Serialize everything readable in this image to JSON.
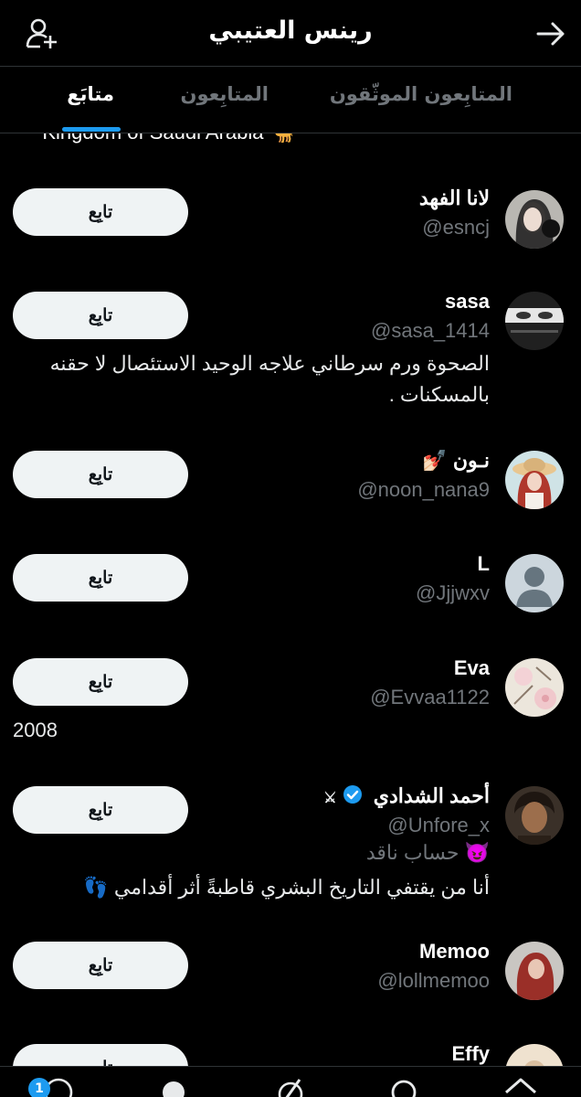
{
  "header": {
    "title": "رينس العتيبي"
  },
  "tabs": [
    {
      "label": "المتابِعون الموثّقون",
      "active": false
    },
    {
      "label": "المتابِعون",
      "active": false
    },
    {
      "label": "متابَع",
      "active": true
    }
  ],
  "top_cut_text": "Kingdom of Saudi Arabia 🐪",
  "users": [
    {
      "name": "لانا الفهد",
      "handle": "@esncj",
      "bio": "",
      "follow_label": "تابِع"
    },
    {
      "name": "sasa",
      "handle": "@sasa_1414",
      "bio": "الصحوة ورم سرطاني علاجه الوحيد الاستئصال لا حقنه بالمسكنات .",
      "follow_label": "تابِع"
    },
    {
      "name": "نـون 💅🏻",
      "handle": "@noon_nana9",
      "bio": "",
      "follow_label": "تابِع"
    },
    {
      "name": "L",
      "handle": "@Jjjwxv",
      "bio": "",
      "follow_label": "تابِع"
    },
    {
      "name": "Eva",
      "handle": "@Evvaa1122",
      "bio": "2008",
      "follow_label": "تابِع"
    },
    {
      "name": "أحمد الشدادي",
      "name_suffix": "⚔",
      "handle": "@Unfore_x",
      "subtitle": "😈 حساب ناقد",
      "bio": "أنا من يقتفي التاريخ البشري قاطبةً أثر أقدامي 👣",
      "follow_label": "تابِع",
      "verified": true
    },
    {
      "name": "Memoo",
      "handle": "@lollmemoo",
      "bio": "",
      "follow_label": "تابِع"
    },
    {
      "name": "Effy",
      "handle": "",
      "bio": "",
      "follow_label": "تابِع"
    }
  ],
  "bottom_nav": {
    "badge_count": "1"
  },
  "colors": {
    "accent": "#1d9bf0",
    "background": "#000000",
    "muted": "#71767b",
    "button": "#eff3f4"
  }
}
